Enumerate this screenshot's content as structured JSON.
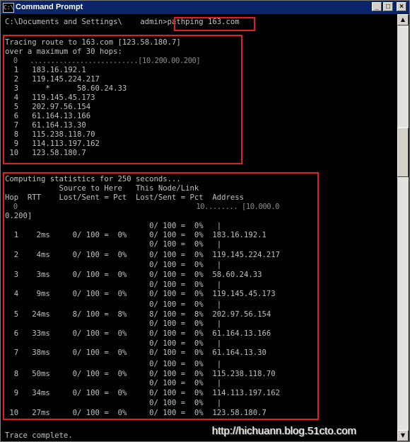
{
  "window": {
    "title": "Command Prompt",
    "icon_glyph": "C:\\",
    "minimize_glyph": "_",
    "maximize_glyph": "□",
    "close_glyph": "×",
    "scroll_up_glyph": "▲",
    "scroll_down_glyph": "▼"
  },
  "console": {
    "prompt": "C:\\Documents and Settings\\    admin>",
    "command": "pathping 163.com",
    "lines": [
      "Tracing route to 163.com [123.58.180.7]",
      "over a maximum of 30 hops:",
      "  0   ..........................[10.200.00.200]",
      "  1   183.16.192.1",
      "  2   119.145.224.217",
      "  3      *      58.60.24.33",
      "  4   119.145.45.173",
      "  5   202.97.56.154",
      "  6   61.164.13.166",
      "  7   61.164.13.30",
      "  8   115.238.118.70",
      "  9   114.113.197.162",
      " 10   123.58.180.7",
      "",
      "Computing statistics for 250 seconds...",
      "            Source to Here   This Node/Link",
      "Hop  RTT    Lost/Sent = Pct  Lost/Sent = Pct  Address",
      "  0                                           10........ [10.000.0",
      "0.200]",
      "                                0/ 100 =  0%   |",
      "  1    2ms     0/ 100 =  0%     0/ 100 =  0%  183.16.192.1",
      "                                0/ 100 =  0%   |",
      "  2    4ms     0/ 100 =  0%     0/ 100 =  0%  119.145.224.217",
      "                                0/ 100 =  0%   |",
      "  3    3ms     0/ 100 =  0%     0/ 100 =  0%  58.60.24.33",
      "                                0/ 100 =  0%   |",
      "  4    9ms     0/ 100 =  0%     0/ 100 =  0%  119.145.45.173",
      "                                0/ 100 =  0%   |",
      "  5   24ms     8/ 100 =  8%     8/ 100 =  8%  202.97.56.154",
      "                                0/ 100 =  0%   |",
      "  6   33ms     0/ 100 =  0%     0/ 100 =  0%  61.164.13.166",
      "                                0/ 100 =  0%   |",
      "  7   38ms     0/ 100 =  0%     0/ 100 =  0%  61.164.13.30",
      "                                0/ 100 =  0%   |",
      "  8   50ms     0/ 100 =  0%     0/ 100 =  0%  115.238.118.70",
      "                                0/ 100 =  0%   |",
      "  9   34ms     0/ 100 =  0%     0/ 100 =  0%  114.113.197.162",
      "                                0/ 100 =  0%   |",
      " 10   27ms     0/ 100 =  0%     0/ 100 =  0%  123.58.180.7",
      "",
      "Trace complete."
    ]
  },
  "watermark": "http://hichuann.blog.51cto.com",
  "colors": {
    "titlebar": "#0a246a",
    "console_bg": "#000000",
    "console_text": "#c0c0c0",
    "highlight_box": "#e02020"
  }
}
